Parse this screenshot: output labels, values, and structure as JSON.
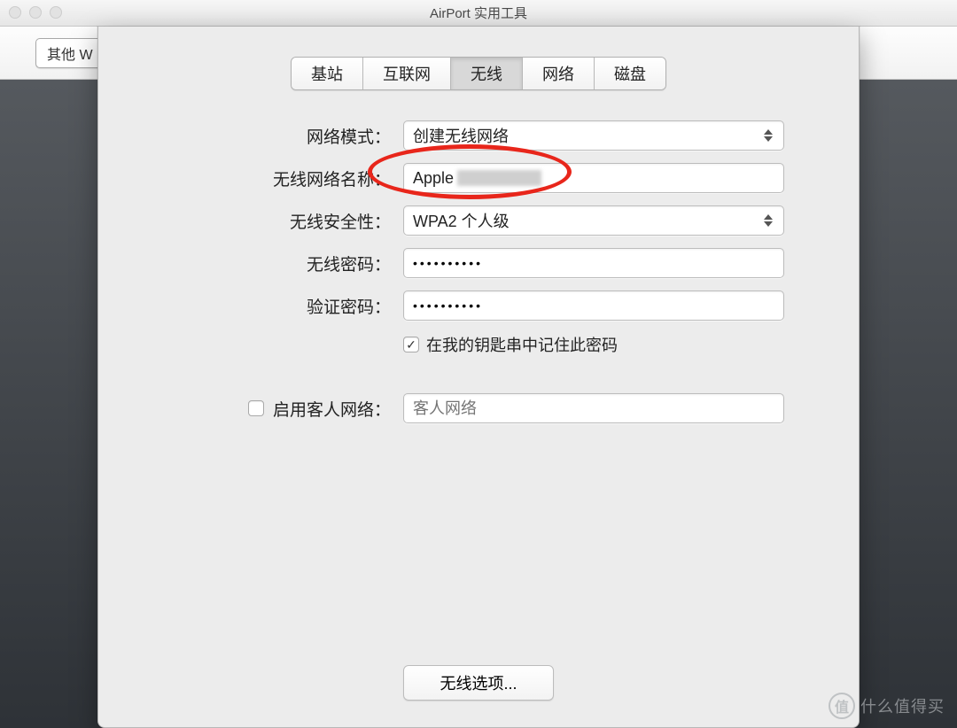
{
  "window": {
    "title": "AirPort 实用工具"
  },
  "background_tab": "其他 W",
  "tabs": [
    "基站",
    "互联网",
    "无线",
    "网络",
    "磁盘"
  ],
  "active_tab_index": 2,
  "form": {
    "network_mode": {
      "label": "网络模式：",
      "value": "创建无线网络"
    },
    "network_name": {
      "label": "无线网络名称：",
      "value": "Apple "
    },
    "security": {
      "label": "无线安全性：",
      "value": "WPA2 个人级"
    },
    "password": {
      "label": "无线密码：",
      "value": "••••••••••"
    },
    "verify_password": {
      "label": "验证密码：",
      "value": "••••••••••"
    },
    "remember": {
      "checked": true,
      "label": "在我的钥匙串中记住此密码"
    },
    "guest": {
      "enabled": false,
      "label": "启用客人网络：",
      "placeholder": "客人网络",
      "value": ""
    }
  },
  "footer": {
    "wireless_options": "无线选项..."
  },
  "watermark": {
    "badge": "值",
    "text": "什么值得买"
  }
}
